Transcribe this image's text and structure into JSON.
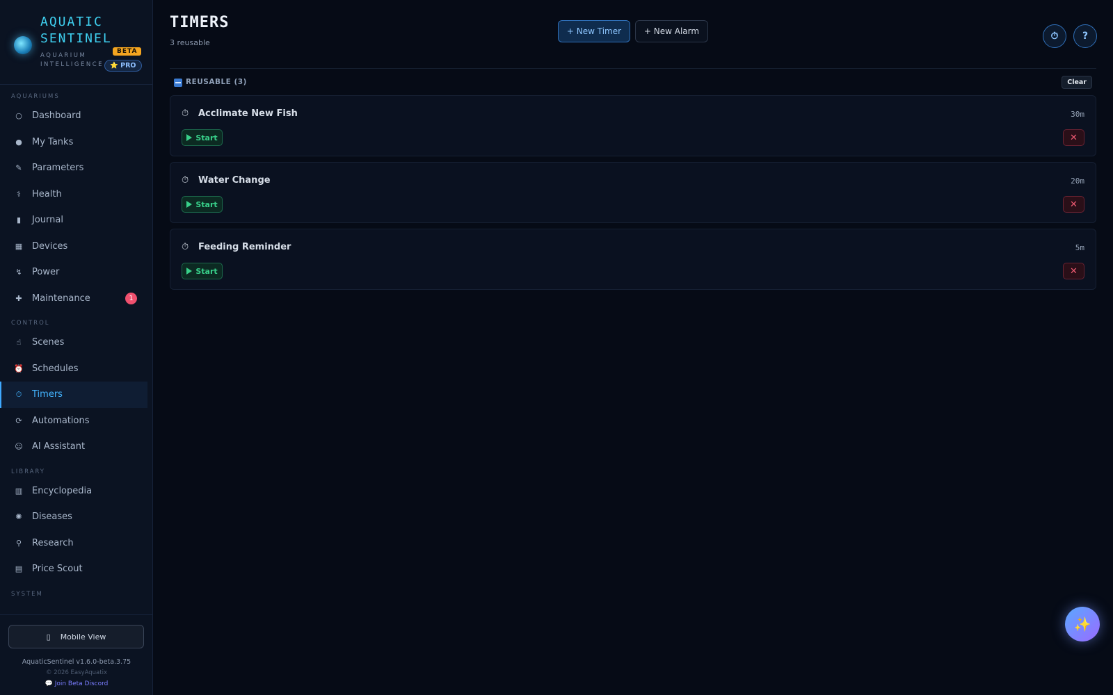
{
  "brand": {
    "title": "AQUATIC SENTINEL",
    "subtitle": "AQUARIUM INTELLIGENCE",
    "beta": "BETA",
    "pro": "⭐ PRO"
  },
  "nav": {
    "sections": [
      {
        "label": "AQUARIUMS",
        "items": [
          {
            "label": "Dashboard",
            "icon": "circle-icon",
            "glyph": "○"
          },
          {
            "label": "My Tanks",
            "icon": "fish-tank-icon",
            "glyph": "●"
          },
          {
            "label": "Parameters",
            "icon": "test-tube-icon",
            "glyph": "✎"
          },
          {
            "label": "Health",
            "icon": "stethoscope-icon",
            "glyph": "⚕"
          },
          {
            "label": "Journal",
            "icon": "notebook-icon",
            "glyph": "▮"
          },
          {
            "label": "Devices",
            "icon": "devices-icon",
            "glyph": "▦"
          },
          {
            "label": "Power",
            "icon": "power-plug-icon",
            "glyph": "↯"
          },
          {
            "label": "Maintenance",
            "icon": "wrench-icon",
            "glyph": "✚",
            "badge": "1"
          }
        ]
      },
      {
        "label": "CONTROL",
        "items": [
          {
            "label": "Scenes",
            "icon": "pointing-hand-icon",
            "glyph": "☝"
          },
          {
            "label": "Schedules",
            "icon": "alarm-clock-icon",
            "glyph": "⏰"
          },
          {
            "label": "Timers",
            "icon": "stopwatch-icon",
            "glyph": "⏱",
            "active": true
          },
          {
            "label": "Automations",
            "icon": "repeat-icon",
            "glyph": "⟳"
          },
          {
            "label": "AI Assistant",
            "icon": "robot-icon",
            "glyph": "☺"
          }
        ]
      },
      {
        "label": "LIBRARY",
        "items": [
          {
            "label": "Encyclopedia",
            "icon": "books-icon",
            "glyph": "▥"
          },
          {
            "label": "Diseases",
            "icon": "microbe-icon",
            "glyph": "✺"
          },
          {
            "label": "Research",
            "icon": "microscope-icon",
            "glyph": "⚲"
          },
          {
            "label": "Price Scout",
            "icon": "cash-register-icon",
            "glyph": "▤"
          }
        ]
      },
      {
        "label": "SYSTEM",
        "items": []
      }
    ]
  },
  "footer": {
    "mobile_view": "Mobile View",
    "version": "AquaticSentinel v1.6.0-beta.3.75",
    "copyright": "© 2026 EasyAquatix",
    "discord": "💬 Join Beta Discord"
  },
  "page": {
    "title": "TIMERS",
    "subtitle": "3 reusable",
    "new_timer": "+ New Timer",
    "new_alarm": "+ New Alarm",
    "help": "?",
    "section_label": "REUSABLE (3)",
    "clear": "Clear"
  },
  "timers": [
    {
      "name": "Acclimate New Fish",
      "duration": "30m",
      "start": "Start"
    },
    {
      "name": "Water Change",
      "duration": "20m",
      "start": "Start"
    },
    {
      "name": "Feeding Reminder",
      "duration": "5m",
      "start": "Start"
    }
  ],
  "colors": {
    "accent": "#3fa9ff",
    "start": "#38d08a",
    "delete": "#ef5a72",
    "beta": "#f4a520"
  }
}
